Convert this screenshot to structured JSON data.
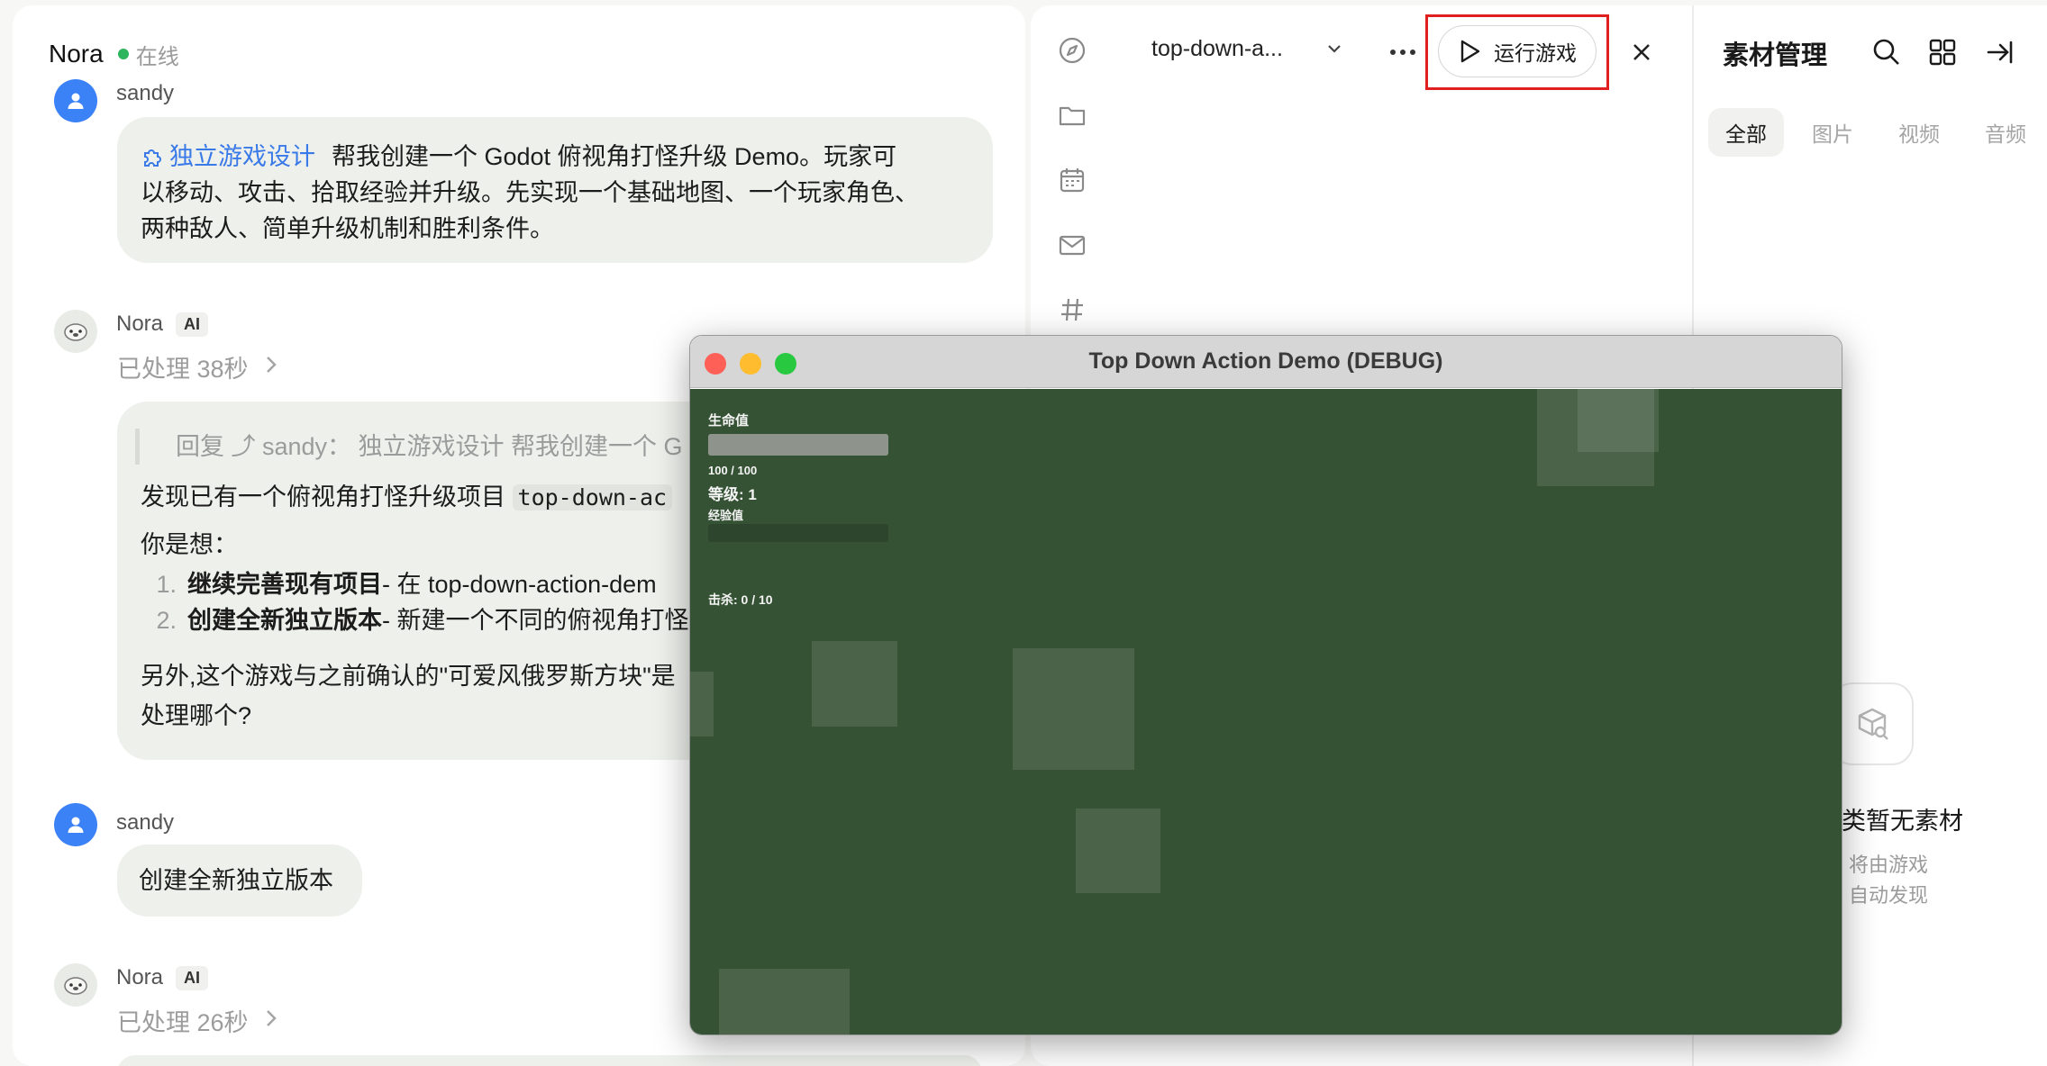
{
  "chat": {
    "contact_name": "Nora",
    "status": "在线",
    "messages": [
      {
        "sender": "sandy",
        "skill": "独立游戏设计",
        "text_lines": [
          "帮我创建一个 Godot 俯视角打怪升级 Demo。玩家可",
          "以移动、攻击、拾取经验并升级。先实现一个基础地图、一个玩家角色、",
          "两种敌人、简单升级机制和胜利条件。"
        ]
      },
      {
        "sender": "Nora",
        "ai_tag": "AI",
        "processed": "已处理 38秒",
        "reply_quote": "回复 ⤴ sandy：  独立游戏设计 帮我创建一个 G",
        "line1_prefix": "发现已有一个俯视角打怪升级项目 ",
        "line1_code": "top-down-ac",
        "line2": "你是想：",
        "options": [
          {
            "num": "1.",
            "bold": "继续完善现有项目",
            "rest": " - 在 top-down-action-dem"
          },
          {
            "num": "2.",
            "bold": "创建全新独立版本",
            "rest": " - 新建一个不同的俯视角打怪"
          }
        ],
        "line3": "另外,这个游戏与之前确认的\"可爱风俄罗斯方块\"是",
        "line4": "处理哪个?"
      },
      {
        "sender": "sandy",
        "text": "创建全新独立版本"
      },
      {
        "sender": "Nora",
        "ai_tag": "AI",
        "processed": "已处理 26秒"
      }
    ]
  },
  "project": {
    "name": "top-down-a...",
    "run_label": "运行游戏",
    "rail_icons": [
      "compass-icon",
      "folder-icon",
      "calendar-icon",
      "mail-icon",
      "hash-icon"
    ]
  },
  "assets": {
    "title": "素材管理",
    "tabs": [
      "全部",
      "图片",
      "视频",
      "音频"
    ],
    "active_tab": "全部",
    "empty_title": "类暂无素材",
    "empty_desc": "将由游戏\n自动发现"
  },
  "game": {
    "window_title": "Top Down Action Demo (DEBUG)",
    "hp_label": "生命值",
    "hp_value": "100 / 100",
    "hp_fraction": 1.0,
    "level_label": "等级: 1",
    "xp_label": "经验值",
    "xp_fraction": 0.0,
    "kills_label": "击杀: 0 / 10",
    "colors": {
      "ground": "#365235",
      "close": "#fe5f57",
      "minimize": "#febc2e",
      "maximize": "#28c840"
    }
  },
  "colors": {
    "accent_red": "#e02020",
    "user_avatar": "#3b82f6",
    "online": "#2db55d",
    "skill_link": "#3a7ae8"
  }
}
